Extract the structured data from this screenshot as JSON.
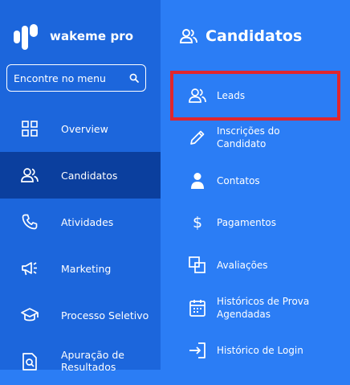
{
  "brand": {
    "name": "wakeme pro"
  },
  "search": {
    "placeholder": "Encontre no menu"
  },
  "main_nav": [
    {
      "label": "Overview",
      "icon": "grid-icon",
      "active": false
    },
    {
      "label": "Candidatos",
      "icon": "users-icon",
      "active": true
    },
    {
      "label": "Atividades",
      "icon": "phone-icon",
      "active": false
    },
    {
      "label": "Marketing",
      "icon": "megaphone-icon",
      "active": false
    },
    {
      "label": "Processo Seletivo",
      "icon": "graduation-cap-icon",
      "active": false
    },
    {
      "label": "Apuração de Resultados",
      "icon": "document-search-icon",
      "active": false
    }
  ],
  "submenu": {
    "title": "Candidatos",
    "items": [
      {
        "label": "Leads",
        "icon": "users-icon",
        "highlighted": true
      },
      {
        "label": "Inscrições do Candidato",
        "icon": "pencil-icon"
      },
      {
        "label": "Contatos",
        "icon": "person-icon"
      },
      {
        "label": "Pagamentos",
        "icon": "dollar-icon"
      },
      {
        "label": "Avaliações",
        "icon": "copy-icon"
      },
      {
        "label": "Históricos de Prova Agendadas",
        "icon": "calendar-icon"
      },
      {
        "label": "Histórico de Login",
        "icon": "login-icon"
      }
    ]
  },
  "colors": {
    "sidebar": "#1c66dc",
    "sidebar_active": "#0b3f9e",
    "submenu": "#2b7df5",
    "highlight": "#e0262d"
  }
}
